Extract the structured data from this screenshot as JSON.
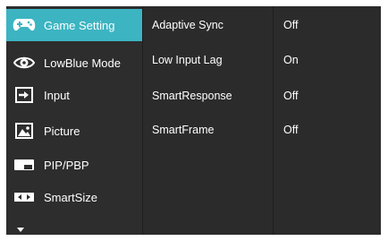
{
  "menu": {
    "items": [
      {
        "label": "Game Setting",
        "icon": "gamepad-icon",
        "active": true
      },
      {
        "label": "LowBlue Mode",
        "icon": "eye-icon",
        "active": false
      },
      {
        "label": "Input",
        "icon": "input-icon",
        "active": false
      },
      {
        "label": "Picture",
        "icon": "picture-icon",
        "active": false
      },
      {
        "label": "PIP/PBP",
        "icon": "pip-icon",
        "active": false
      },
      {
        "label": "SmartSize",
        "icon": "smartsize-icon",
        "active": false
      }
    ],
    "more_icon": "chevron-down-icon"
  },
  "submenu": {
    "items": [
      "Adaptive Sync",
      "Low Input Lag",
      "SmartResponse",
      "SmartFrame"
    ]
  },
  "values": {
    "items": [
      "Off",
      "On",
      "Off",
      "Off"
    ]
  },
  "colors": {
    "accent": "#3cb4c2",
    "panel": "#2d2d2d",
    "text": "#ffffff"
  }
}
